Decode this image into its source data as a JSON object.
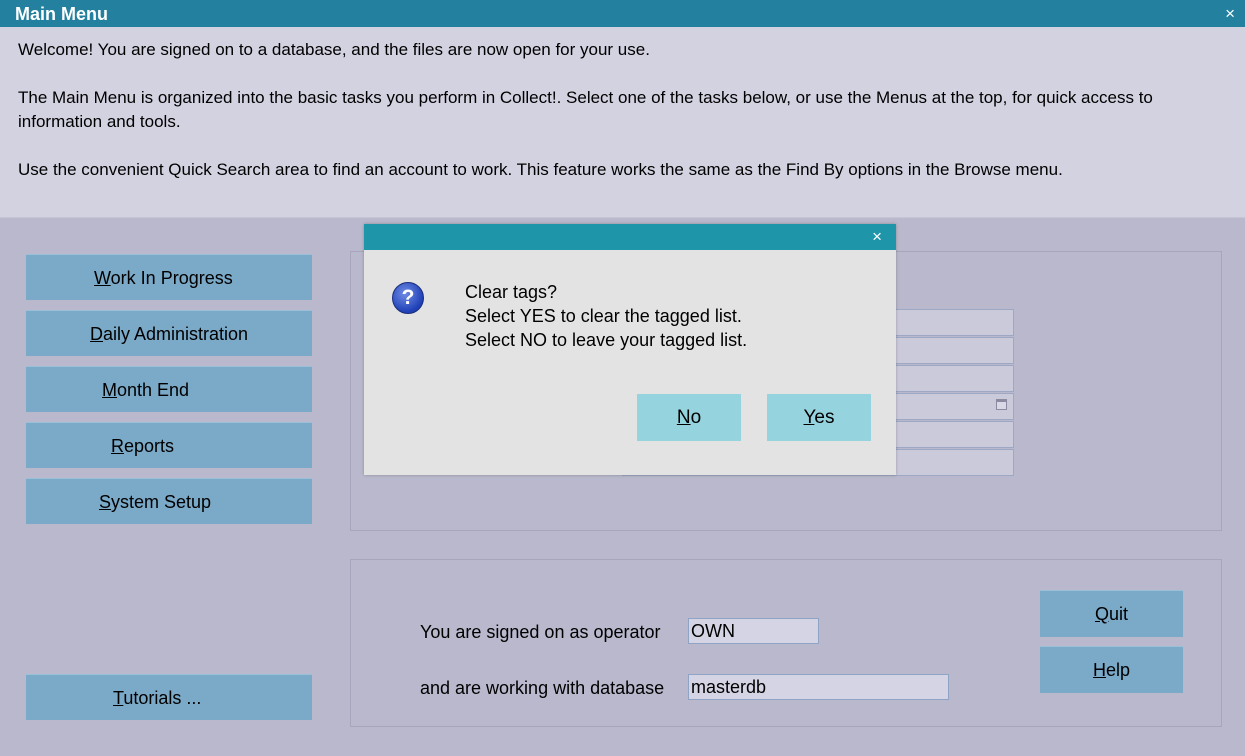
{
  "window": {
    "title": "Main Menu",
    "close_glyph": "×"
  },
  "intro": {
    "line1": "Welcome! You are signed on to a database, and the files are now open for your use.",
    "line2": "The Main Menu is organized into the basic tasks you perform in Collect!. Select one of the tasks below, or use the Menus at the top, for quick access to information and tools.",
    "line3": "Use the convenient Quick Search area to find an account to work. This feature works the same as the Find By options in the Browse menu."
  },
  "nav": {
    "work_in_progress": {
      "key": "W",
      "rest": "ork In Progress"
    },
    "daily_admin": {
      "key": "D",
      "rest": "aily Administration"
    },
    "month_end": {
      "key": "M",
      "rest": "onth End"
    },
    "reports": {
      "key": "R",
      "rest": "eports"
    },
    "system_setup": {
      "key": "S",
      "rest": "ystem Setup"
    },
    "tutorials": {
      "key": "T",
      "rest": "utorials ..."
    }
  },
  "session": {
    "operator_label": "You are signed on as operator",
    "operator_value": "OWN",
    "database_label": "and are working with database",
    "database_value": "masterdb"
  },
  "side_buttons": {
    "quit": {
      "key": "Q",
      "rest": "uit"
    },
    "help": {
      "key": "H",
      "rest": "elp"
    }
  },
  "dialog": {
    "close_glyph": "×",
    "icon": "question-icon",
    "icon_glyph": "?",
    "line1": "Clear tags?",
    "line2": "Select YES to clear the tagged list.",
    "line3": "Select NO to leave your tagged list.",
    "no": {
      "key": "N",
      "rest": "o"
    },
    "yes": {
      "key": "Y",
      "rest": "es"
    }
  },
  "colors": {
    "titlebar": "#23809e",
    "dialog_titlebar": "#1f95a9",
    "nav_button": "#7ba9c8",
    "dialog_button": "#95d4de",
    "background": "#b9b8cc",
    "intro_background": "#d3d2e1"
  }
}
